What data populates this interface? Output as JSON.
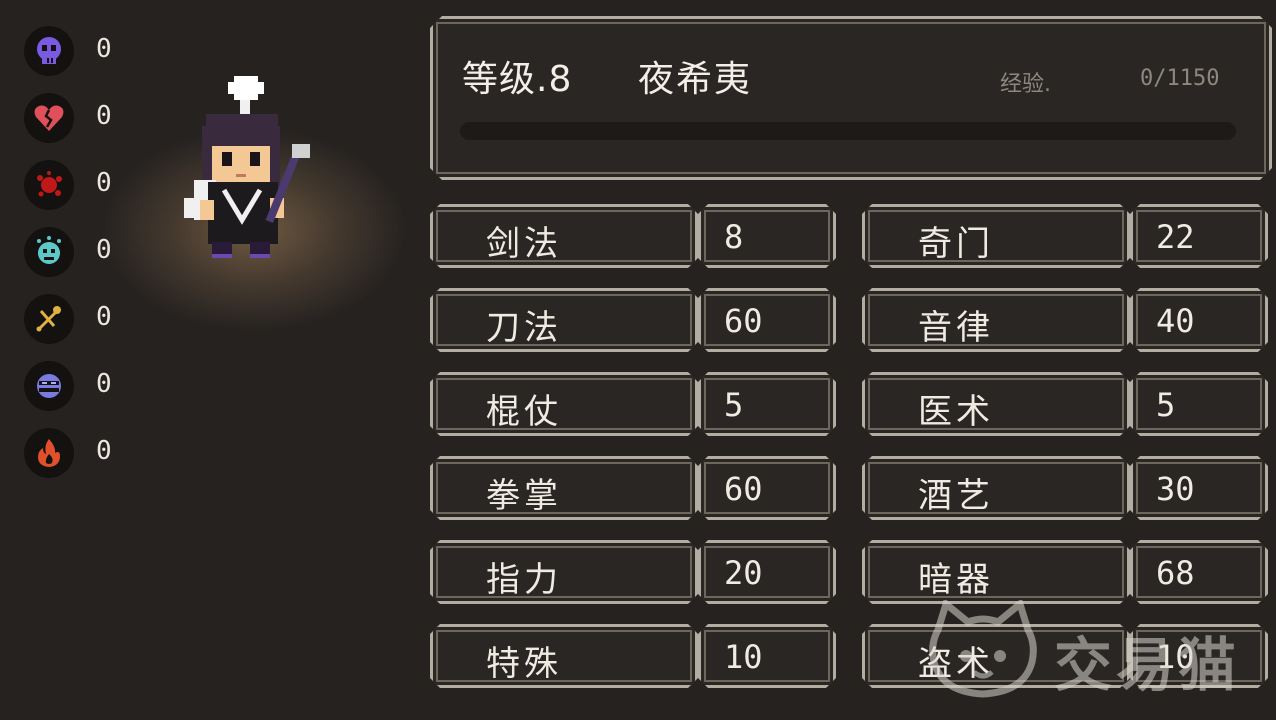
{
  "status_effects": [
    {
      "icon": "skull-icon",
      "color": "#7a5ae0",
      "count": "0"
    },
    {
      "icon": "broken-heart-icon",
      "color": "#e0505a",
      "count": "0"
    },
    {
      "icon": "blood-splat-icon",
      "color": "#c01818",
      "count": "0"
    },
    {
      "icon": "dizzy-face-icon",
      "color": "#5ec8c8",
      "count": "0"
    },
    {
      "icon": "crossed-bones-icon",
      "color": "#e0b040",
      "count": "0"
    },
    {
      "icon": "frozen-face-icon",
      "color": "#7a7ae0",
      "count": "0"
    },
    {
      "icon": "flame-icon",
      "color": "#e0502a",
      "count": "0"
    }
  ],
  "character": {
    "level_label": "等级.8",
    "name": "夜希夷",
    "exp_label": "经验.",
    "exp_value": "0/1150",
    "exp_progress": 0
  },
  "skills_left": [
    {
      "name": "剑法",
      "value": "8"
    },
    {
      "name": "刀法",
      "value": "60"
    },
    {
      "name": "棍仗",
      "value": "5"
    },
    {
      "name": "拳掌",
      "value": "60"
    },
    {
      "name": "指力",
      "value": "20"
    },
    {
      "name": "特殊",
      "value": "10"
    }
  ],
  "skills_right": [
    {
      "name": "奇门",
      "value": "22"
    },
    {
      "name": "音律",
      "value": "40"
    },
    {
      "name": "医术",
      "value": "5"
    },
    {
      "name": "酒艺",
      "value": "30"
    },
    {
      "name": "暗器",
      "value": "68"
    },
    {
      "name": "盗术",
      "value": "10"
    }
  ],
  "watermark": {
    "text": "交易猫",
    "icon": "cat-logo-icon"
  },
  "colors": {
    "background": "#252220",
    "frame_border": "#b3ada1",
    "text": "#efebe2",
    "muted_text": "#8d877d"
  }
}
